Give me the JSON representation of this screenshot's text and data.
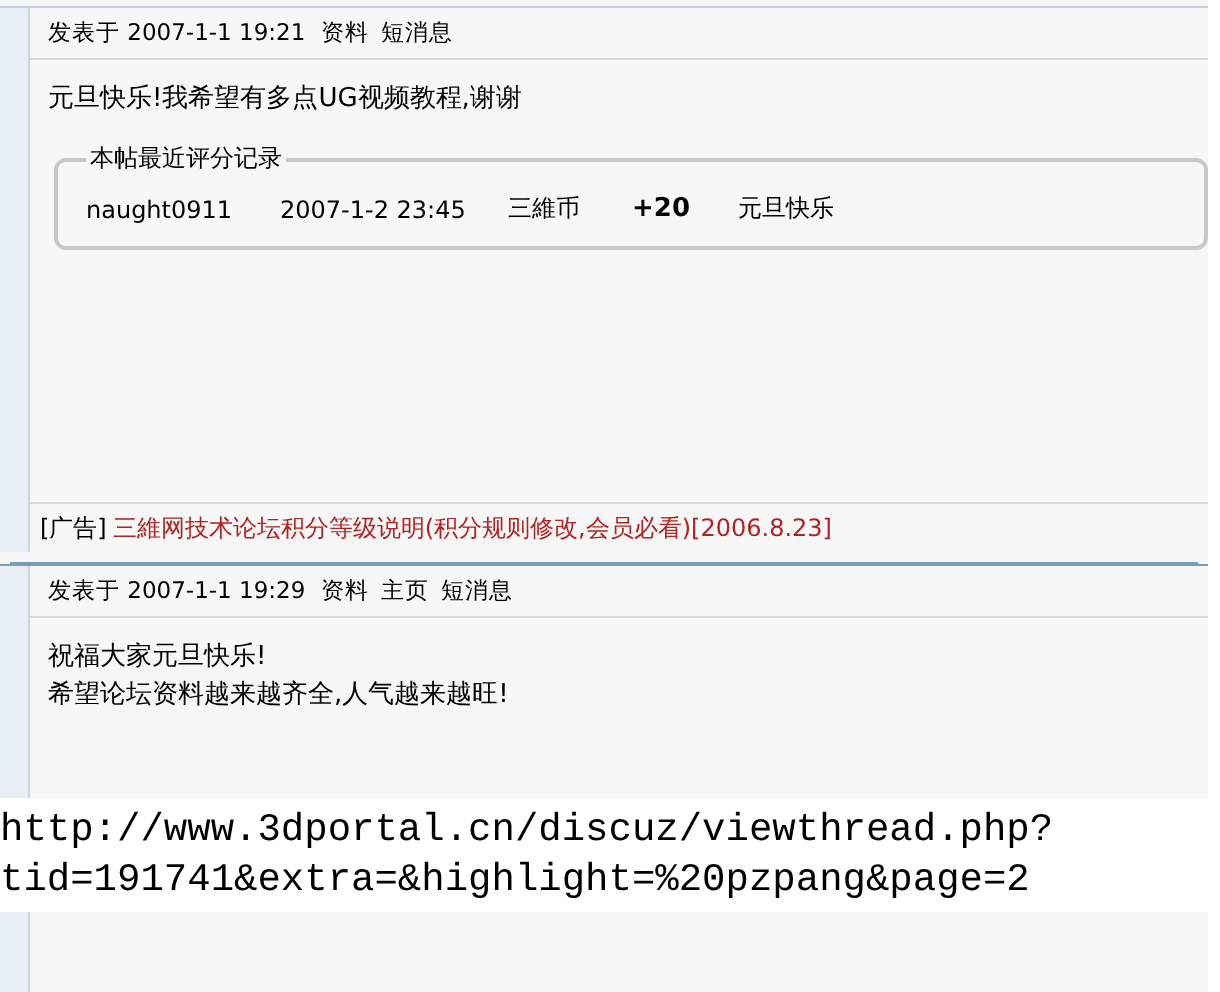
{
  "posts": [
    {
      "posted": "发表于 2007-1-1 19:21",
      "links": [
        "资料",
        "短消息"
      ],
      "message": [
        "元旦快乐!我希望有多点UG视频教程,谢谢"
      ],
      "ratings": {
        "legend": "本帖最近评分记录",
        "rows": [
          {
            "user": "naught0911",
            "time": "2007-1-2 23:45",
            "currency": "三維币",
            "score": "+20",
            "reason": "元旦快乐"
          }
        ]
      },
      "ad": {
        "tag": "[广告]",
        "text": "三維网技术论坛积分等级说明(积分规则修改,会员必看)[2006.8.23]"
      }
    },
    {
      "posted": "发表于 2007-1-1 19:29",
      "links": [
        "资料",
        "主页",
        "短消息"
      ],
      "message": [
        "祝福大家元旦快乐!",
        "希望论坛资料越来越齐全,人气越来越旺!"
      ]
    }
  ],
  "caption": [
    "http://www.3dportal.cn/discuz/viewthread.php?",
    "tid=191741&extra=&highlight=%20pzpang&page=2"
  ]
}
